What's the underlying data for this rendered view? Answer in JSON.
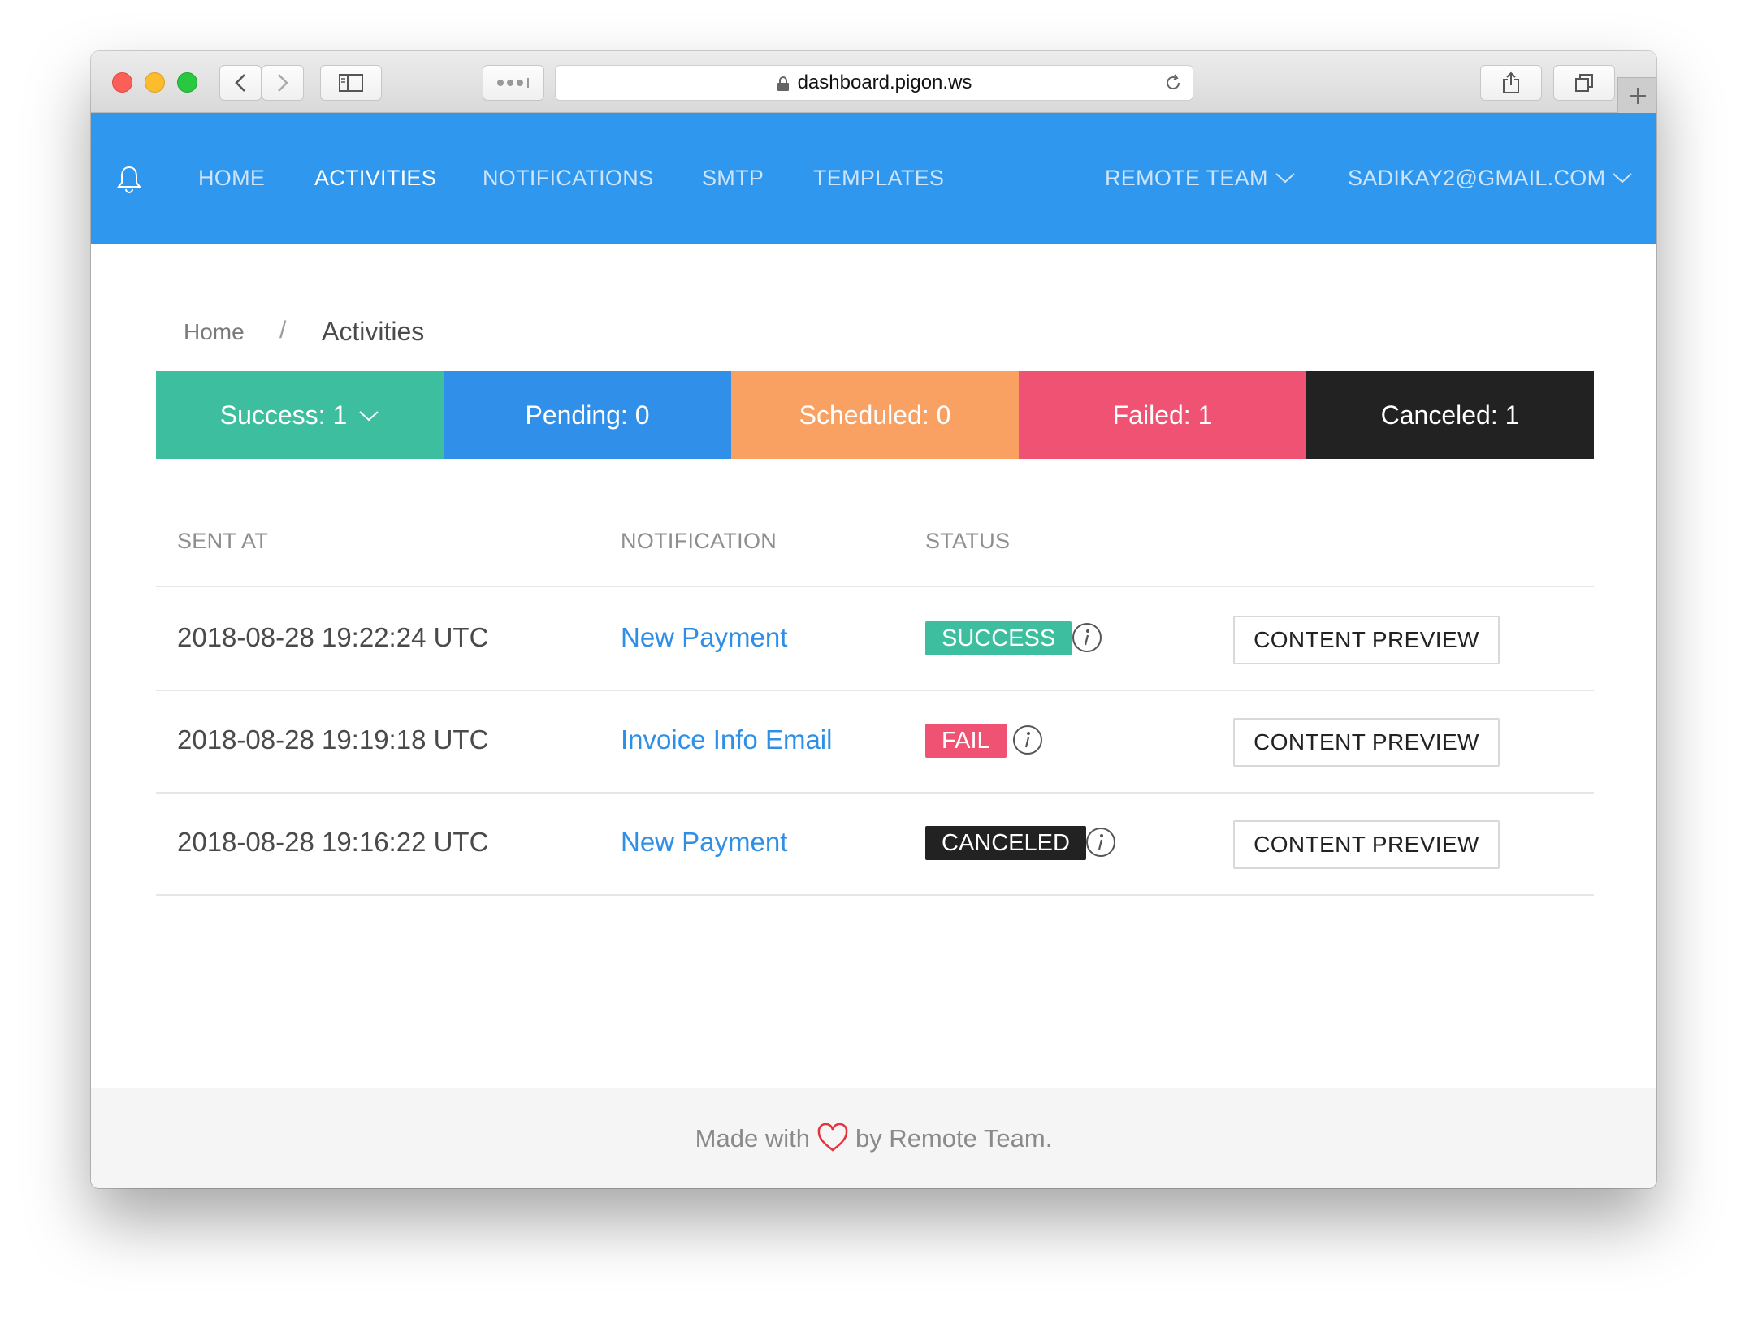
{
  "browser": {
    "url": "dashboard.pigon.ws",
    "icons": [
      "back-icon",
      "forward-icon",
      "sidebar-icon",
      "extensions-icon",
      "lock-icon",
      "reload-icon",
      "share-icon",
      "tabs-icon",
      "new-tab-icon"
    ]
  },
  "nav": {
    "icon": "bell-icon",
    "links": [
      "HOME",
      "ACTIVITIES",
      "NOTIFICATIONS",
      "SMTP",
      "TEMPLATES"
    ],
    "active": "ACTIVITIES",
    "team_menu": "REMOTE TEAM",
    "user_menu": "SADIKAY2@GMAIL.COM",
    "color": "#2f97ee"
  },
  "breadcrumb": {
    "home": "Home",
    "separator": "/",
    "current": "Activities"
  },
  "status_tabs": [
    {
      "label": "Success: 1",
      "color": "#3dbf9f",
      "dropdown": true
    },
    {
      "label": "Pending: 0",
      "color": "#2f8fe9"
    },
    {
      "label": "Scheduled: 0",
      "color": "#f9a162"
    },
    {
      "label": "Failed: 1",
      "color": "#ef5272"
    },
    {
      "label": "Canceled: 1",
      "color": "#222222"
    }
  ],
  "table": {
    "headers": [
      "SENT AT",
      "NOTIFICATION",
      "STATUS"
    ],
    "rows": [
      {
        "sent_at": "2018-08-28 19:22:24 UTC",
        "notification": "New Payment",
        "status": "SUCCESS",
        "status_color": "#3dbf9f",
        "action": "CONTENT PREVIEW"
      },
      {
        "sent_at": "2018-08-28 19:19:18 UTC",
        "notification": "Invoice Info Email",
        "status": "FAIL",
        "status_color": "#ef5272",
        "action": "CONTENT PREVIEW"
      },
      {
        "sent_at": "2018-08-28 19:16:22 UTC",
        "notification": "New Payment",
        "status": "CANCELED",
        "status_color": "#222222",
        "action": "CONTENT PREVIEW"
      }
    ]
  },
  "footer": {
    "prefix": "Made with",
    "icon": "heart-icon",
    "suffix": "by Remote Team."
  }
}
